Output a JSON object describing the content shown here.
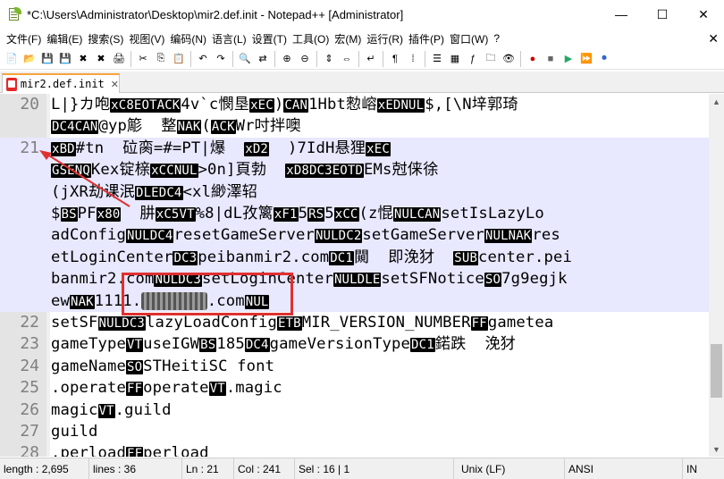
{
  "window": {
    "title": "*C:\\Users\\Administrator\\Desktop\\mir2.def.init - Notepad++ [Administrator]",
    "minimize": "—",
    "maximize": "☐",
    "close": "✕"
  },
  "menu": {
    "items": [
      "文件(F)",
      "编辑(E)",
      "搜索(S)",
      "视图(V)",
      "编码(N)",
      "语言(L)",
      "设置(T)",
      "工具(O)",
      "宏(M)",
      "运行(R)",
      "插件(P)",
      "窗口(W)",
      "?"
    ],
    "close": "✕"
  },
  "toolbar": {
    "icons": [
      "new-file-icon",
      "open-file-icon",
      "save-icon",
      "save-all-icon",
      "close-icon",
      "close-all-icon",
      "print-icon",
      "cut-icon",
      "copy-icon",
      "paste-icon",
      "undo-icon",
      "redo-icon",
      "find-icon",
      "replace-icon",
      "zoom-in-icon",
      "zoom-out-icon",
      "sync-vertical-icon",
      "sync-horizontal-icon",
      "word-wrap-icon",
      "show-all-chars-icon",
      "indent-guide-icon",
      "lang-icon",
      "doc-map-icon",
      "function-list-icon",
      "folder-workspace-icon",
      "monitor-icon",
      "record-macro-icon",
      "stop-macro-icon",
      "play-macro-icon",
      "run-macro-multiple-icon",
      "save-macro-icon"
    ]
  },
  "tab": {
    "label": "mir2.def.init",
    "close": "✕"
  },
  "editor": {
    "lines": [
      {
        "num": "20",
        "rows": [
          [
            [
              "t",
              "L|}カ咆"
            ],
            [
              "c",
              "xC8EOTACK"
            ],
            [
              "t",
              "4v`c憫垦"
            ],
            [
              "c",
              "xEC"
            ],
            [
              "t",
              ")"
            ],
            [
              "c",
              "CAN"
            ],
            [
              "t",
              "1Hbt愸嵱"
            ],
            [
              "c",
              "xEDNUL"
            ],
            [
              "t",
              "$,[\\N垶郭琦"
            ]
          ],
          [
            [
              "c",
              "DC4CAN"
            ],
            [
              "t",
              "@yp簓  整"
            ],
            [
              "c",
              "NAK"
            ],
            [
              "t",
              "("
            ],
            [
              "c",
              "ACK"
            ],
            [
              "t",
              "Wr吋拌噢"
            ]
          ]
        ]
      },
      {
        "num": "21",
        "sel": true,
        "rows": [
          [
            [
              "c",
              "xBD"
            ],
            [
              "t",
              "#tn  砬脔=#=PT|爆  "
            ],
            [
              "c",
              "xD2"
            ],
            [
              "t",
              "  )7IdH悬狸"
            ],
            [
              "c",
              "xEC"
            ]
          ],
          [
            [
              "c",
              "GSENQ"
            ],
            [
              "t",
              "Kex锭榇"
            ],
            [
              "c",
              "xCCNUL"
            ],
            [
              "t",
              ">0n]頁勃  "
            ],
            [
              "c",
              "xD8DC3EOTD"
            ],
            [
              "t",
              "EMs尅俫徐"
            ]
          ],
          [
            [
              "t",
              "(jXR劫课泯"
            ],
            [
              "c",
              "DLEDC4"
            ],
            [
              "t",
              "<xl緲澤轺"
            ]
          ],
          [
            [
              "t",
              "$"
            ],
            [
              "c",
              "BS"
            ],
            [
              "t",
              "PF"
            ],
            [
              "c",
              "x80"
            ],
            [
              "t",
              "  肼"
            ],
            [
              "c",
              "xC5VT"
            ],
            [
              "t",
              "%8|dL孜篱"
            ],
            [
              "c",
              "xF1"
            ],
            [
              "t",
              "5"
            ],
            [
              "c",
              "RS"
            ],
            [
              "t",
              "5"
            ],
            [
              "c",
              "xCC"
            ],
            [
              "t",
              "(z惃"
            ],
            [
              "c",
              "NULCAN"
            ],
            [
              "t",
              "setIsLazyLo"
            ]
          ],
          [
            [
              "t",
              "adConfig"
            ],
            [
              "c",
              "NULDC4"
            ],
            [
              "t",
              "resetGameServer"
            ],
            [
              "c",
              "NULDC2"
            ],
            [
              "t",
              "setGameServer"
            ],
            [
              "c",
              "NULNAK"
            ],
            [
              "t",
              "res"
            ]
          ],
          [
            [
              "t",
              "etLoginCenter"
            ],
            [
              "c",
              "DC3"
            ],
            [
              "t",
              "peibanmir2.com"
            ],
            [
              "c",
              "DC1"
            ],
            [
              "t",
              "闚  即浼犲  "
            ],
            [
              "c",
              "SUB"
            ],
            [
              "t",
              "center.pei"
            ]
          ],
          [
            [
              "t",
              "banmir2.com"
            ],
            [
              "c",
              "NULDC3"
            ],
            [
              "t",
              "setLoginCenter"
            ],
            [
              "c",
              "NULDLE"
            ],
            [
              "t",
              "setSFNotice"
            ],
            [
              "c",
              "SO"
            ],
            [
              "t",
              "7g9egjk"
            ]
          ],
          [
            [
              "t",
              "ew"
            ],
            [
              "c",
              "NAK"
            ],
            [
              "t",
              "1111."
            ],
            [
              "b",
              "xxxxxxx"
            ],
            [
              "t",
              ".com"
            ],
            [
              "c",
              "NUL"
            ]
          ]
        ]
      },
      {
        "num": "22",
        "rows": [
          [
            [
              "t",
              "setSF"
            ],
            [
              "c",
              "NULDC3"
            ],
            [
              "t",
              "lazyLoadConfig"
            ],
            [
              "c",
              "ETB"
            ],
            [
              "t",
              "MIR_VERSION_NUMBER"
            ],
            [
              "c",
              "FF"
            ],
            [
              "t",
              "gametea"
            ]
          ]
        ]
      },
      {
        "num": "23",
        "rows": [
          [
            [
              "t",
              "gameType"
            ],
            [
              "c",
              "VT"
            ],
            [
              "t",
              "useIGW"
            ],
            [
              "c",
              "BS"
            ],
            [
              "t",
              "185"
            ],
            [
              "c",
              "DC4"
            ],
            [
              "t",
              "gameVersionType"
            ],
            [
              "c",
              "DC1"
            ],
            [
              "t",
              "鍩跌  浼犲"
            ]
          ]
        ]
      },
      {
        "num": "24",
        "rows": [
          [
            [
              "t",
              "gameName"
            ],
            [
              "c",
              "SO"
            ],
            [
              "t",
              "STHeitiSC font"
            ]
          ]
        ]
      },
      {
        "num": "25",
        "rows": [
          [
            [
              "t",
              ".operate"
            ],
            [
              "c",
              "FF"
            ],
            [
              "t",
              "operate"
            ],
            [
              "c",
              "VT"
            ],
            [
              "t",
              ".magic"
            ]
          ]
        ]
      },
      {
        "num": "26",
        "rows": [
          [
            [
              "t",
              "magic"
            ],
            [
              "c",
              "VT"
            ],
            [
              "t",
              ".guild"
            ]
          ]
        ]
      },
      {
        "num": "27",
        "rows": [
          [
            [
              "t",
              "guild"
            ]
          ]
        ]
      },
      {
        "num": "28",
        "rows": [
          [
            [
              "t",
              ".perload"
            ],
            [
              "c",
              "FF"
            ],
            [
              "t",
              "perload"
            ]
          ]
        ]
      }
    ]
  },
  "status": {
    "length": "length : 2,695",
    "lines": "lines : 36",
    "ln": "Ln : 21",
    "col": "Col : 241",
    "sel": "Sel : 16 | 1",
    "eol": "Unix (LF)",
    "encoding": "ANSI",
    "mode": "IN"
  }
}
